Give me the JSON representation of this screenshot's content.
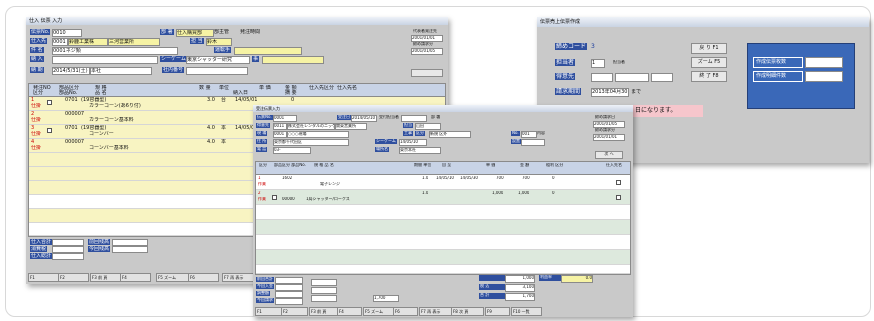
{
  "win1": {
    "title": "仕入 伝票  入力",
    "r1": {
      "l1": "伝票No.",
      "v1": "0010",
      "l2": "部 署",
      "v2": "仕入購買部",
      "l3": "部主管",
      "l4": "発注時間"
    },
    "r2": {
      "l1": "仕入先",
      "v1": "0001",
      "v1b": "鈴鹿工業株",
      "v1c": "三河営業所",
      "l2": "担 当",
      "v2": "鈴木"
    },
    "r3": {
      "l1": "件 名",
      "v1": "0001ネジ類",
      "l2": "運転手"
    },
    "r4": {
      "l1": "納 入",
      "v1": "",
      "l2": "シーケーム",
      "v2": "東京シャッター研究",
      "l3": "事"
    },
    "r5": {
      "l1": "納 期",
      "v1": "2014/5/31(土)",
      "v1b": "本社",
      "l2": "社内番号"
    },
    "side": {
      "a": "代表者発注先",
      "b": "2001/01/01",
      "c": "締め請求分",
      "d": "2001/01/05"
    },
    "grid": {
      "h1": "発注NO",
      "h2": "部品区分",
      "h3": "規 格",
      "h4": "数 量",
      "h5": "単位",
      "h6": "単 価",
      "h7": "金 額",
      "h8": "仕入先区分",
      "h9": "仕入先名",
      "h1b": "区分",
      "h2b": "部品No.",
      "h3b": "品 名",
      "h6b": "納入日",
      "h7b": "摘 要",
      "rows": [
        {
          "a": "1",
          "b": "仕掛",
          "c": "0701",
          "d": "(19容器型)",
          "e": "カラーコーン(あ6り付)",
          "f": "3.0",
          "g": "台",
          "h": "14/05/01",
          "i": "0"
        },
        {
          "a": "2",
          "b": "仕掛",
          "c": "000007",
          "d": "カラーコーン基本料",
          "f": "",
          "g": ""
        },
        {
          "a": "3",
          "b": "仕掛",
          "c": "0701",
          "d": "(19容器型)",
          "e": "コーンバー",
          "f": "4.0",
          "g": "本",
          "h": "14/05/01"
        },
        {
          "a": "4",
          "b": "仕掛",
          "c": "000007",
          "d": "コーンバー基本料",
          "f": "4.0",
          "g": "本"
        }
      ]
    },
    "totals": {
      "a": "仕入合計",
      "b": "消費税",
      "c": "仕入総計",
      "d": "前回残高",
      "e": "今回残高"
    },
    "fkeys": [
      "F1",
      "F2",
      "F3 前 頁",
      "F4",
      "F5 ズーム",
      "F6",
      "F7 再 表示",
      "F8"
    ]
  },
  "win2": {
    "title": "受注伝票入力",
    "r1": {
      "l1": "伝票No.",
      "v1": "0001",
      "l2": "受注日",
      "v2": "2014/05/10",
      "l3": "受付担当者",
      "l4": "部 署"
    },
    "r2": {
      "l1": "得意先",
      "v1": "0011",
      "v1b": "株式会社レンタルのニッケン",
      "v1c": "関東営業所",
      "l2": "担当",
      "v2": "山田"
    },
    "r3": {
      "l1": "現 場",
      "v1": "0001",
      "v1b": "○○○現場",
      "l2": "工事",
      "l3": "区分",
      "v3": "新規 区外",
      "l4": "No.",
      "v4": "001",
      "v4b": "内容"
    },
    "r4": {
      "l1": "住 所",
      "v1": "東京都千代田区",
      "l2": "シーケーム",
      "v2": "14/05/10",
      "l3": "設置"
    },
    "r5": {
      "l1": "電 話",
      "v1": "03-",
      "l2": "場所名",
      "v2": "東京本社"
    },
    "side": {
      "a": "締め請求日",
      "b": "2001/01/05",
      "c": "締め請求分",
      "d": "2001/01/01",
      "e": "次 へ"
    },
    "grid": {
      "h1": "区分",
      "h2": "部品区分 部品No.",
      "h3": "規 格 品 名",
      "h4": "期間 単位",
      "h5": "自 至",
      "h6": "単 価",
      "h7": "金 額",
      "h8": "粗利 区分",
      "h9": "仕入先名",
      "rows": [
        {
          "a": "1",
          "b": "作業",
          "c": "1602",
          "d": "電子レンジ",
          "e": "1.0",
          "f": "14/05/10",
          "g": "14/05/30",
          "h": "700",
          "i": "700",
          "j": "0"
        },
        {
          "a": "2",
          "b": "作業",
          "c": "00000",
          "d": "1局シャッター/ロークス",
          "e": "1.0",
          "h": "1,000",
          "i": "1,000",
          "j": "0"
        }
      ]
    },
    "totals": {
      "a": "前回合計",
      "b": "今回入金",
      "c": "調整額",
      "d": "今回請求",
      "e": "1,000",
      "f": "3,100",
      "g": "1,700",
      "h": "税 込",
      "i": "合 計",
      "j": "1,700",
      "k": "利益率",
      "l": "0.0"
    },
    "fkeys": [
      "F1",
      "F2",
      "F3 前 頁",
      "F4",
      "F5 ズーム",
      "F6",
      "F7 再 表示",
      "F8 次 頁",
      "F9",
      "F10 一覧"
    ]
  },
  "win3": {
    "title": "伝票売上伝票作成",
    "l1": "締めコード",
    "v1": "3",
    "l2": "担当者",
    "v2": "1",
    "v2b": "担当者",
    "l3": "得意先",
    "v3": "",
    "v3b": "",
    "l4": "請求期間",
    "v4": "2013年04月30日",
    "v4b": "まで",
    "msg": "日になります。",
    "b1": "戻 り F1",
    "b2": "ズーム F5",
    "b3": "終 了 F8",
    "p1": "作成伝票枚数",
    "p2": "作成明細件数"
  }
}
